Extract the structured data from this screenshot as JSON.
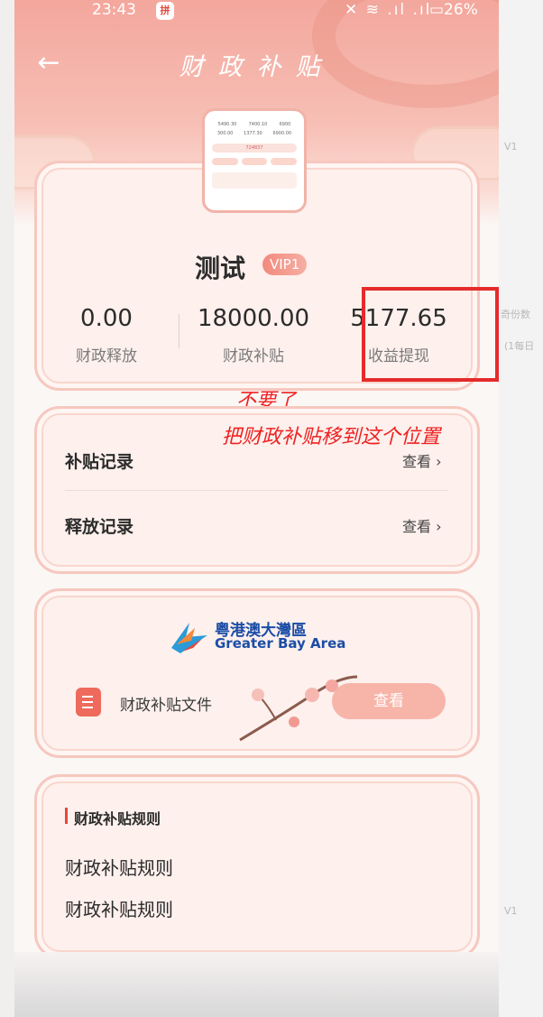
{
  "status_bar": {
    "time": "23:43",
    "app_badge": "拼",
    "signal": "✕ ≋ .ıl .ıl",
    "battery": "▭26%"
  },
  "nav": {
    "back_icon": "←",
    "title": "财政补贴"
  },
  "profile": {
    "name": "测试",
    "vip": "VIP1"
  },
  "stats": [
    {
      "value": "0.00",
      "label": "财政释放"
    },
    {
      "value": "18000.00",
      "label": "财政补贴"
    },
    {
      "value": "5177.65",
      "label": "收益提现"
    }
  ],
  "annotation": {
    "line1": "不要了",
    "line2": "把财政补贴移到这个位置"
  },
  "records": [
    {
      "label": "补贴记录",
      "action": "查看 ›"
    },
    {
      "label": "释放记录",
      "action": "查看 ›"
    }
  ],
  "gba": {
    "cn": "粤港澳大灣區",
    "en": "Greater Bay Area",
    "doc_label": "财政补贴文件",
    "doc_button": "查看"
  },
  "rules": {
    "title": "财政补贴规则",
    "items": [
      "财政补贴规则",
      "财政补贴规则"
    ]
  },
  "right_strip": [
    "V1",
    "奇份数",
    "(1每日",
    "V1"
  ],
  "thumbnail": {
    "row1": [
      "5490.30",
      "7400.10",
      "6900"
    ],
    "row2": [
      "300.00",
      "1377.30",
      "6900.00"
    ],
    "bar_text": "724837"
  },
  "colors": {
    "accent": "#e5473b",
    "annotation": "#ee2222",
    "card_border": "#f6c8bf",
    "vip": "#f28a7d"
  }
}
